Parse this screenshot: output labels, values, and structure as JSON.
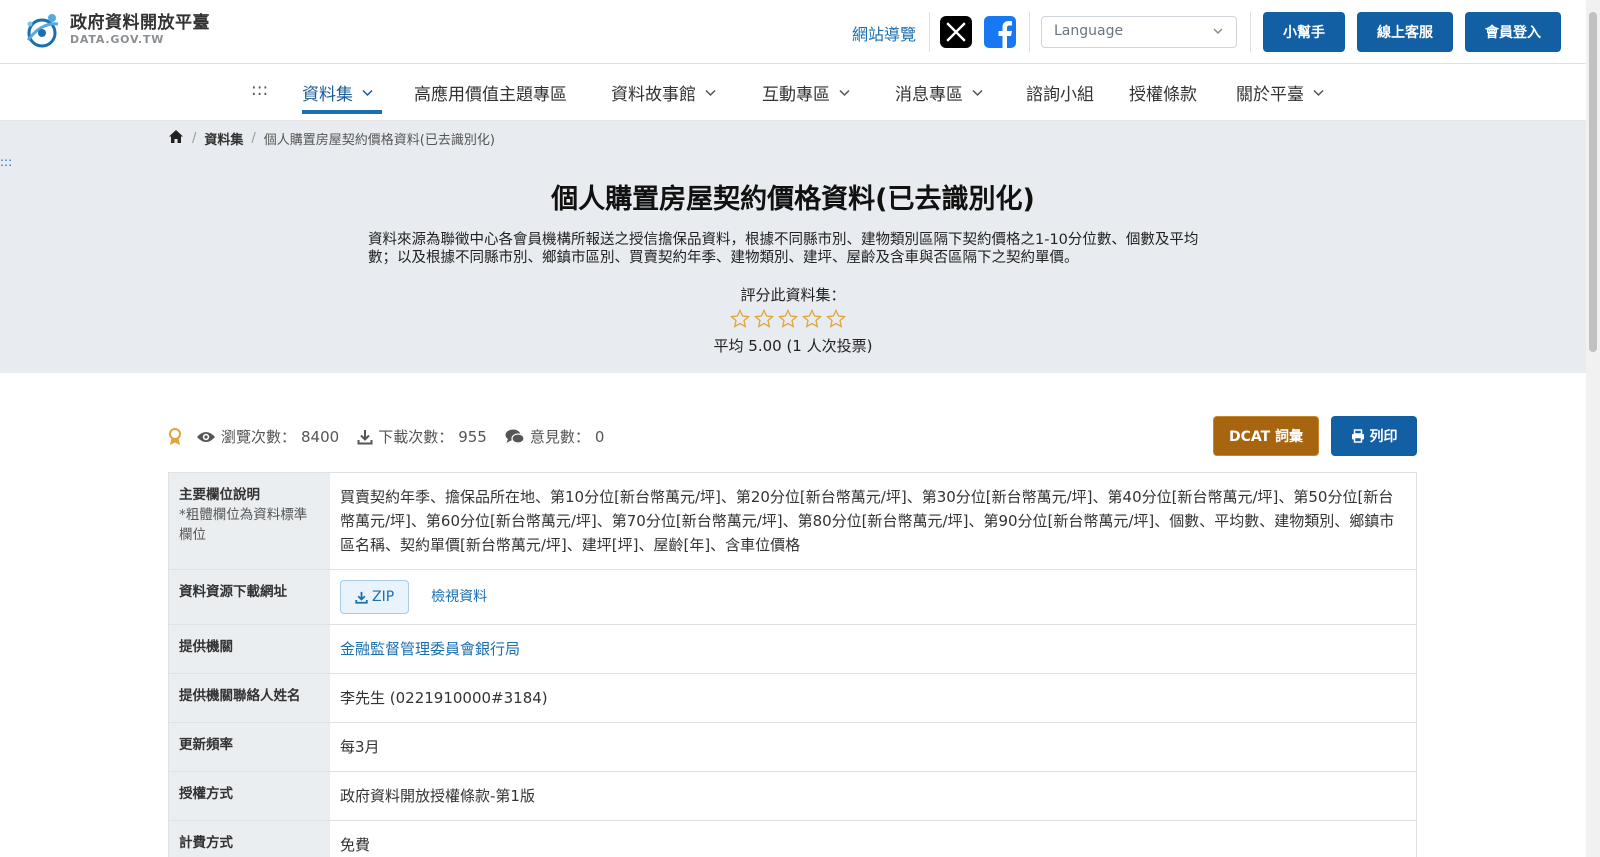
{
  "header": {
    "logo_cn": "政府資料開放平臺",
    "logo_en": "DATA.GOV.TW",
    "sitemap": "網站導覽",
    "language_placeholder": "Language",
    "btn_helper": "小幫手",
    "btn_service": "線上客服",
    "btn_login": "會員登入"
  },
  "nav": {
    "skip": ":::",
    "items": [
      "資料集",
      "高應用價值主題專區",
      "資料故事館",
      "互動專區",
      "消息專區",
      "諮詢小組",
      "授權條款",
      "關於平臺"
    ]
  },
  "breadcrumb": {
    "level1": "資料集",
    "current": "個人購置房屋契約價格資料(已去識別化)"
  },
  "skip_link": ":::",
  "dataset": {
    "title": "個人購置房屋契約價格資料(已去識別化)",
    "description": "資料來源為聯徵中心各會員機構所報送之授信擔保品資料，根據不同縣市別、建物類別區隔下契約價格之1-10分位數、個數及平均數；以及根據不同縣市別、鄉鎮市區別、買賣契約年季、建物類別、建坪、屋齡及含車與否區隔下之契約單價。",
    "rate_label": "評分此資料集：",
    "rating_average": "平均 5.00 (1 人次投票)"
  },
  "stats": {
    "views_label": "瀏覽次數：",
    "views": "8400",
    "downloads_label": "下載次數：",
    "downloads": "955",
    "comments_label": "意見數：",
    "comments": "0"
  },
  "actions": {
    "dcat": "DCAT 詞彙",
    "print": "列印"
  },
  "table": {
    "fields_label": "主要欄位說明",
    "fields_note": "*粗體欄位為資料標準欄位",
    "fields_value": "買賣契約年季、擔保品所在地、第10分位[新台幣萬元/坪]、第20分位[新台幣萬元/坪]、第30分位[新台幣萬元/坪]、第40分位[新台幣萬元/坪]、第50分位[新台幣萬元/坪]、第60分位[新台幣萬元/坪]、第70分位[新台幣萬元/坪]、第80分位[新台幣萬元/坪]、第90分位[新台幣萬元/坪]、個數、平均數、建物類別、鄉鎮市區名稱、契約單價[新台幣萬元/坪]、建坪[坪]、屋齡[年]、含車位價格",
    "download_label": "資料資源下載網址",
    "zip": "ZIP",
    "view_data": "檢視資料",
    "provider_label": "提供機關",
    "provider_value": "金融監督管理委員會銀行局",
    "contact_label": "提供機關聯絡人姓名",
    "contact_value": "李先生 (0221910000#3184)",
    "freq_label": "更新頻率",
    "freq_value": "每3月",
    "license_label": "授權方式",
    "license_value": "政府資料開放授權條款-第1版",
    "fee_label": "計費方式",
    "fee_value": "免費"
  },
  "colors": {
    "primary": "#125fa3",
    "link": "#1a6fb0",
    "dcat": "#a7650f",
    "hero_bg": "#e8ecf0",
    "star": "#e0a33a"
  }
}
